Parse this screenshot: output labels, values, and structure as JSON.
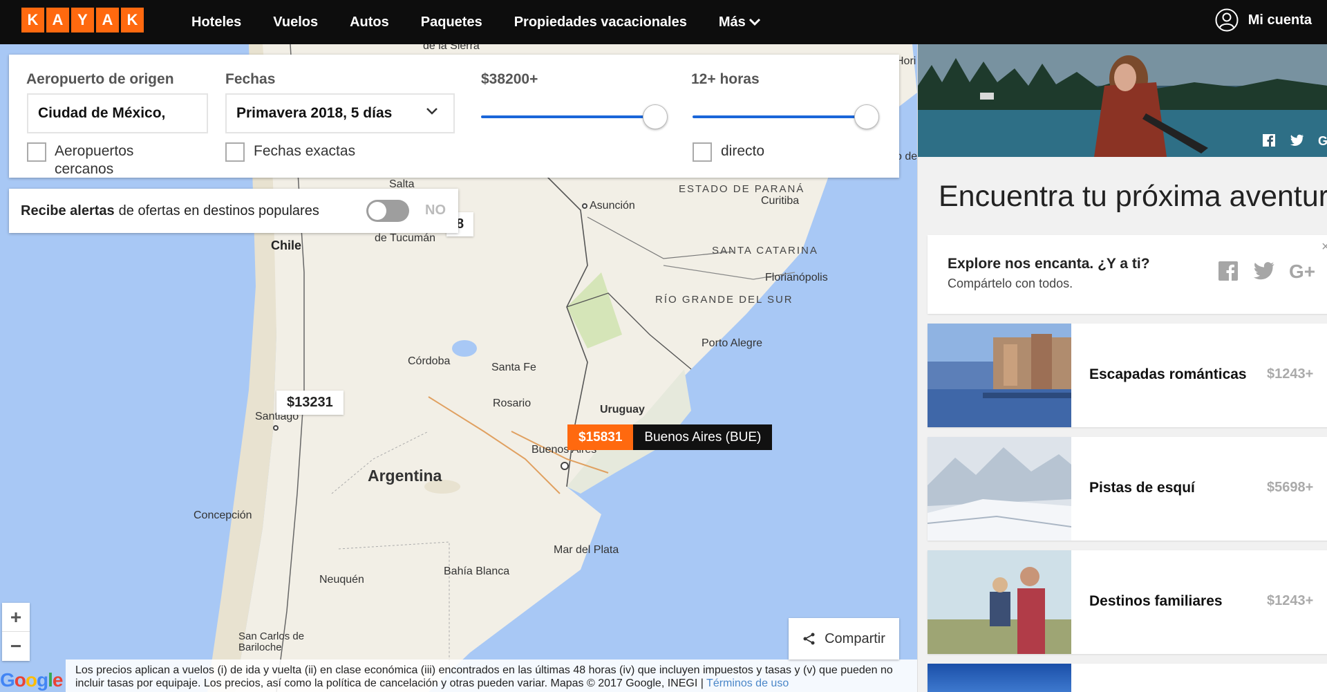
{
  "nav": {
    "logo_letters": [
      "K",
      "A",
      "Y",
      "A",
      "K"
    ],
    "links": [
      "Hoteles",
      "Vuelos",
      "Autos",
      "Paquetes",
      "Propiedades vacacionales",
      "Más"
    ],
    "account": "Mi cuenta"
  },
  "filters": {
    "origin_label": "Aeropuerto de origen",
    "origin_value": "Ciudad de México,",
    "nearby_label": "Aeropuertos cercanos",
    "dates_label": "Fechas",
    "dates_value": "Primavera 2018, 5 días",
    "exact_dates_label": "Fechas exactas",
    "price_label": "$38200+",
    "price_fraction": 1.0,
    "duration_label": "12+ horas",
    "duration_fraction": 1.0,
    "direct_label": "directo"
  },
  "alerts": {
    "bold": "Recibe alertas",
    "text": "de ofertas en destinos populares",
    "toggle_state": "NO"
  },
  "map": {
    "labels": {
      "salta": "Salta",
      "tucuman": "de Tucumán",
      "chile": "Chile",
      "asuncion": "Asunción",
      "parana": "ESTADO DE PARANÁ",
      "curitiba": "Curitiba",
      "santa_catarina": "SANTA CATARINA",
      "florianopolis": "Florianópolis",
      "rio_grande": "RÍO GRANDE DEL SUR",
      "porto_alegre": "Porto Alegre",
      "cordoba": "Córdoba",
      "santa_fe": "Santa Fe",
      "rosario": "Rosario",
      "uruguay": "Uruguay",
      "santiago": "Santiago",
      "buenos_aires": "Buenos Aires",
      "argentina": "Argentina",
      "concepcion": "Concepción",
      "mar_del_plata": "Mar del Plata",
      "bahia_blanca": "Bahía Blanca",
      "neuquen": "Neuquén",
      "bariloche": "San Carlos de Bariloche",
      "sierra": "de la Sierra",
      "edge_top": "Hori",
      "edge_mid": "o de"
    },
    "price_partial": "8",
    "price_santiago": "$13231",
    "selected_price": "$15831",
    "selected_name": "Buenos Aires (BUE)",
    "zoom_in": "+",
    "zoom_out": "−",
    "share": "Compartir",
    "google": "Google",
    "disclaimer": "Los precios aplican a vuelos (i) de ida y vuelta (ii) en clase económica (iii) encontrados en las últimas 48 horas (iv) que incluyen impuestos y tasas y (v) que pueden no incluir tasas por equipaje. Los precios, así como la política de cancelación y otras pueden variar. Mapas © 2017 Google, INEGI |",
    "terms": "Términos de uso"
  },
  "sidebar": {
    "headline": "Encuentra tu próxima aventura",
    "explore_title": "Explore nos encanta. ¿Y a ti?",
    "explore_sub": "Compártelo con todos.",
    "close": "×",
    "cards": [
      {
        "title": "Escapadas románticas",
        "price": "$1243+"
      },
      {
        "title": "Pistas de esquí",
        "price": "$5698+"
      },
      {
        "title": "Destinos familiares",
        "price": "$1243+"
      }
    ]
  },
  "colors": {
    "brand": "#ff690f",
    "nav_bg": "#0d0d0d",
    "slider": "#1a66d9",
    "water": "#a8c8f5",
    "land": "#f2efe6"
  }
}
